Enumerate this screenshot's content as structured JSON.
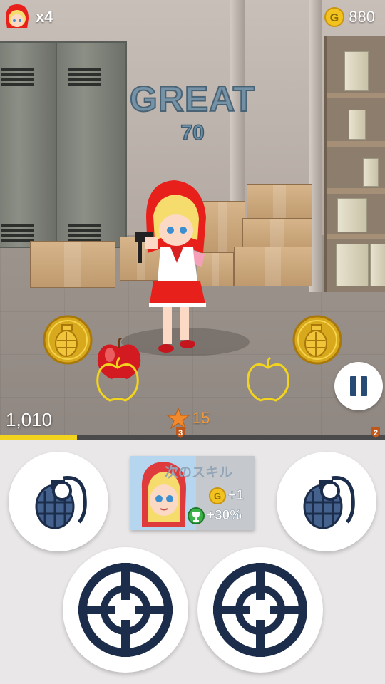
{
  "hud": {
    "lives": "x4",
    "coins": "880"
  },
  "feedback": {
    "rating": "GREAT",
    "points": "70"
  },
  "score": "1,010",
  "stage": {
    "value": "15",
    "progress_fraction": 0.2,
    "start_marker": "3",
    "end_marker": "2"
  },
  "skill": {
    "title": "次のスキル",
    "coin_bonus": "+1",
    "trophy_bonus": "+30%"
  },
  "colors": {
    "accent_navy": "#274b75",
    "coin_gold": "#f2c21e",
    "progress": "#f2d31e",
    "stage_orange": "#f09a3e"
  },
  "icons": [
    "avatar-icon",
    "coin-icon",
    "star-icon",
    "grenade-icon",
    "apple-icon",
    "pause-icon",
    "crosshair-icon",
    "trophy-icon"
  ]
}
